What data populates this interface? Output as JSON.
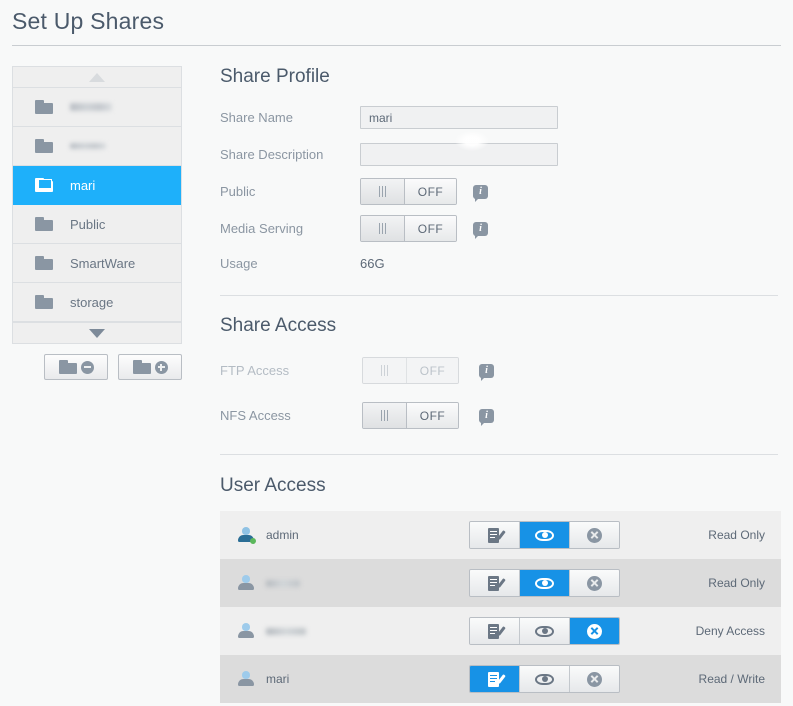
{
  "page": {
    "title": "Set Up Shares"
  },
  "sidebar": {
    "scroll_up_icon": "triangle-up-icon",
    "scroll_down_icon": "triangle-down-icon",
    "items": [
      {
        "label": "",
        "redacted": true,
        "selected": false,
        "icon": "folder-icon"
      },
      {
        "label": "",
        "redacted": true,
        "selected": false,
        "icon": "folder-icon"
      },
      {
        "label": "mari",
        "redacted": false,
        "selected": true,
        "icon": "folder-icon"
      },
      {
        "label": "Public",
        "redacted": false,
        "selected": false,
        "icon": "folder-icon"
      },
      {
        "label": "SmartWare",
        "redacted": false,
        "selected": false,
        "icon": "folder-icon"
      },
      {
        "label": "storage",
        "redacted": false,
        "selected": false,
        "icon": "folder-icon"
      }
    ],
    "remove_button": {
      "name": "remove-share-button",
      "icon": "folder-minus-icon"
    },
    "add_button": {
      "name": "add-share-button",
      "icon": "folder-plus-icon"
    }
  },
  "share_profile": {
    "heading": "Share Profile",
    "share_name": {
      "label": "Share Name",
      "value": "mari",
      "placeholder": ""
    },
    "share_description": {
      "label": "Share Description",
      "value": "",
      "placeholder": ""
    },
    "public": {
      "label": "Public",
      "state": "OFF",
      "info_icon": "info-icon",
      "disabled": false
    },
    "media_serving": {
      "label": "Media Serving",
      "state": "OFF",
      "info_icon": "info-icon",
      "disabled": false
    },
    "usage": {
      "label": "Usage",
      "value": "66G"
    }
  },
  "share_access": {
    "heading": "Share Access",
    "ftp_access": {
      "label": "FTP Access",
      "state": "OFF",
      "info_icon": "info-icon",
      "disabled": true
    },
    "nfs_access": {
      "label": "NFS Access",
      "state": "OFF",
      "info_icon": "info-icon",
      "disabled": false
    }
  },
  "user_access": {
    "heading": "User Access",
    "permission_icons": [
      "read-write-icon",
      "read-only-icon",
      "deny-access-icon"
    ],
    "rows": [
      {
        "user": "admin",
        "redacted": false,
        "admin": true,
        "selected": 1,
        "permission": "Read Only"
      },
      {
        "user": "",
        "redacted": true,
        "admin": false,
        "selected": 1,
        "permission": "Read Only"
      },
      {
        "user": "",
        "redacted": true,
        "admin": false,
        "selected": 2,
        "permission": "Deny Access"
      },
      {
        "user": "mari",
        "redacted": false,
        "admin": false,
        "selected": 0,
        "permission": "Read / Write"
      }
    ]
  },
  "colors": {
    "accent_blue": "#1eb0fa",
    "button_blue": "#1792e6",
    "page_bg": "#f8f9f9",
    "row_odd": "#efefef",
    "row_even": "#dcdcdc",
    "text": "#5d6977",
    "label_text": "#8b96a2"
  }
}
